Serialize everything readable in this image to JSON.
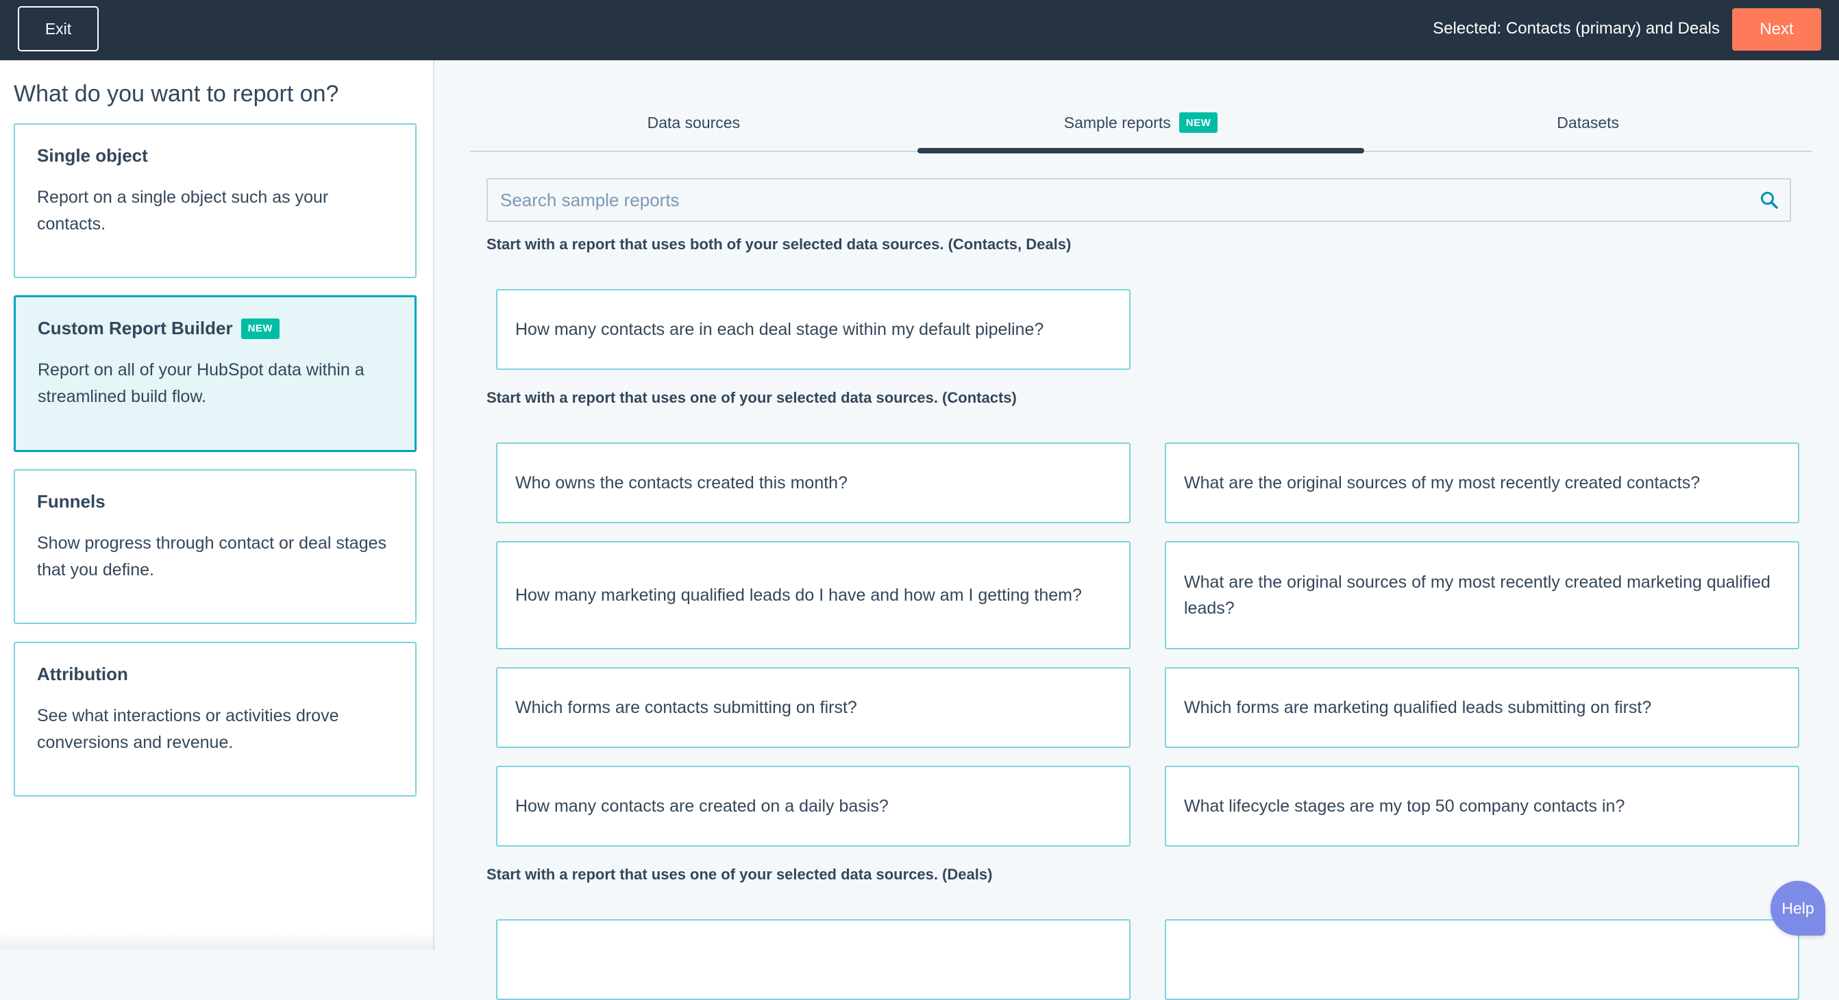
{
  "topbar": {
    "exit_label": "Exit",
    "selected_text": "Selected: Contacts (primary) and Deals",
    "next_label": "Next"
  },
  "left_panel": {
    "title": "What do you want to report on?",
    "options": [
      {
        "title": "Single object",
        "description": "Report on a single object such as your contacts.",
        "badge": ""
      },
      {
        "title": "Custom Report Builder",
        "description": "Report on all of your HubSpot data within a streamlined build flow.",
        "badge": "NEW"
      },
      {
        "title": "Funnels",
        "description": "Show progress through contact or deal stages that you define.",
        "badge": ""
      },
      {
        "title": "Attribution",
        "description": "See what interactions or activities drove conversions and revenue.",
        "badge": ""
      }
    ]
  },
  "tabs": [
    {
      "label": "Data sources",
      "badge": ""
    },
    {
      "label": "Sample reports",
      "badge": "NEW"
    },
    {
      "label": "Datasets",
      "badge": ""
    }
  ],
  "active_tab": "Sample reports",
  "search": {
    "placeholder": "Search sample reports",
    "value": ""
  },
  "sections": [
    {
      "label": "Start with a report that uses both of your selected data sources. (Contacts, Deals)",
      "reports": [
        "How many contacts are in each deal stage within my default pipeline?"
      ]
    },
    {
      "label": "Start with a report that uses one of your selected data sources. (Contacts)",
      "reports": [
        "Who owns the contacts created this month?",
        "What are the original sources of my most recently created contacts?",
        "How many marketing qualified leads do I have and how am I getting them?",
        "What are the original sources of my most recently created marketing qualified leads?",
        "Which forms are contacts submitting on first?",
        "Which forms are marketing qualified leads submitting on first?",
        "How many contacts are created on a daily basis?",
        "What lifecycle stages are my top 50 company contacts in?"
      ]
    },
    {
      "label": "Start with a report that uses one of your selected data sources. (Deals)",
      "reports": [
        "",
        ""
      ]
    }
  ],
  "help_label": "Help",
  "colors": {
    "topbar": "#253342",
    "accent_orange": "#ff7a59",
    "accent_teal": "#00a4bd",
    "badge_green": "#00bda5"
  },
  "icons": {
    "search": "search-icon"
  }
}
